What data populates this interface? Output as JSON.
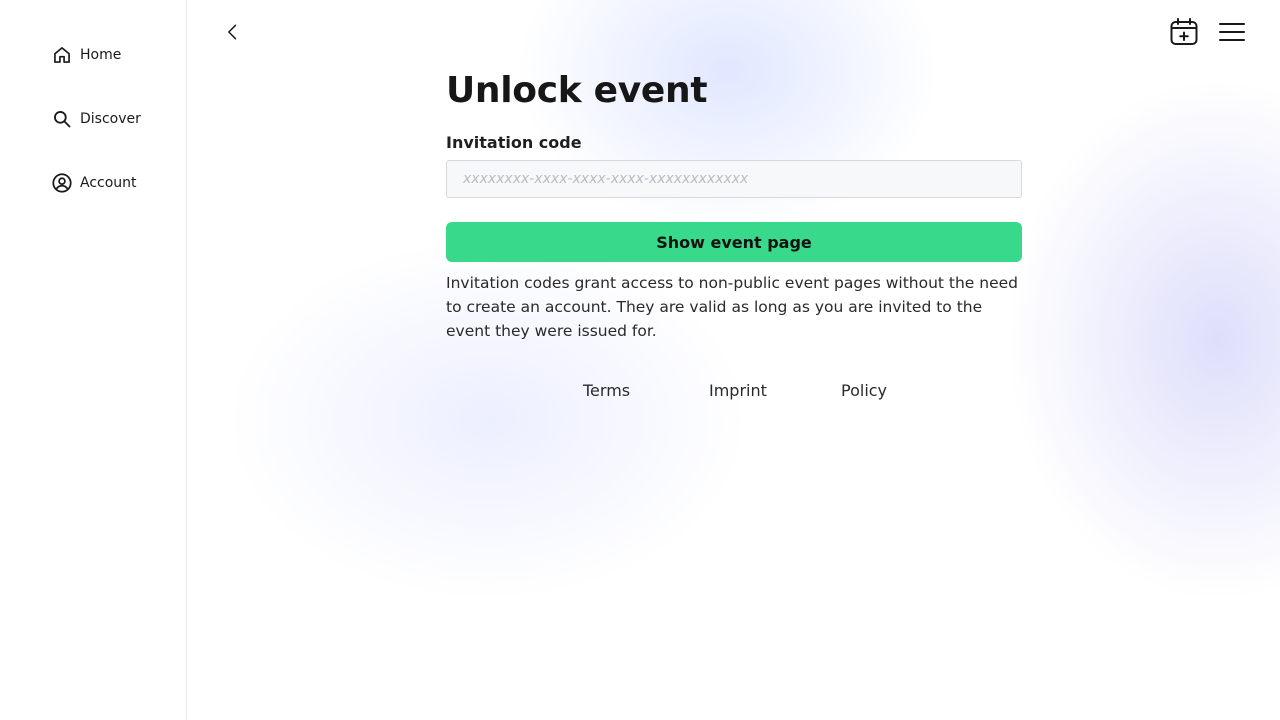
{
  "sidebar": {
    "items": [
      {
        "label": "Home",
        "icon": "home-icon"
      },
      {
        "label": "Discover",
        "icon": "search-icon"
      },
      {
        "label": "Account",
        "icon": "account-circle-icon"
      }
    ]
  },
  "header": {
    "back_icon": "chevron-left-icon",
    "add_event_icon": "calendar-plus-icon",
    "menu_icon": "hamburger-menu-icon"
  },
  "main": {
    "title": "Unlock event",
    "code_field": {
      "label": "Invitation code",
      "value": "",
      "placeholder": "xxxxxxxx-xxxx-xxxx-xxxx-xxxxxxxxxxxx"
    },
    "submit_label": "Show event page",
    "help_text": "Invitation codes grant access to non-public event pages without the need to create an account. They are valid as long as you are invited to the event they were issued for."
  },
  "footer": {
    "links": [
      {
        "label": "Terms"
      },
      {
        "label": "Imprint"
      },
      {
        "label": "Policy"
      }
    ]
  },
  "colors": {
    "accent": "#38d98a",
    "text": "#171717",
    "input_bg": "#f7f8fa"
  }
}
